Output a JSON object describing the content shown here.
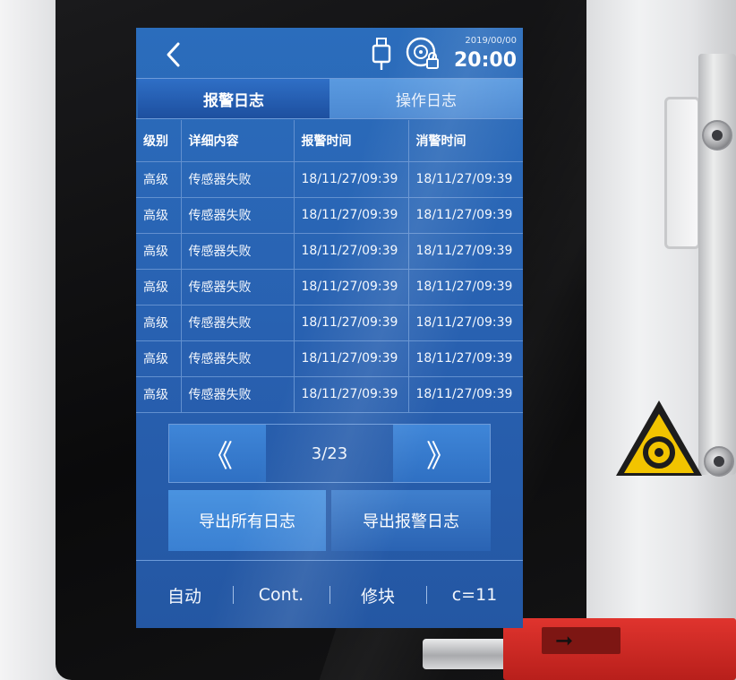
{
  "header": {
    "date": "2019/00/00",
    "time": "20:00",
    "icons": [
      "back-chevron-icon",
      "usb-icon",
      "lock-disc-icon"
    ]
  },
  "tabs": [
    {
      "label": "报警日志",
      "active": true
    },
    {
      "label": "操作日志",
      "active": false
    }
  ],
  "table": {
    "columns": [
      "级别",
      "详细内容",
      "报警时间",
      "消警时间"
    ],
    "rows": [
      [
        "高级",
        "传感器失败",
        "18/11/27/09:39",
        "18/11/27/09:39"
      ],
      [
        "高级",
        "传感器失败",
        "18/11/27/09:39",
        "18/11/27/09:39"
      ],
      [
        "高级",
        "传感器失败",
        "18/11/27/09:39",
        "18/11/27/09:39"
      ],
      [
        "高级",
        "传感器失败",
        "18/11/27/09:39",
        "18/11/27/09:39"
      ],
      [
        "高级",
        "传感器失败",
        "18/11/27/09:39",
        "18/11/27/09:39"
      ],
      [
        "高级",
        "传感器失败",
        "18/11/27/09:39",
        "18/11/27/09:39"
      ],
      [
        "高级",
        "传感器失败",
        "18/11/27/09:39",
        "18/11/27/09:39"
      ]
    ]
  },
  "pager": {
    "prev_symbol": "《",
    "next_symbol": "》",
    "page_label": "3/23"
  },
  "actions": {
    "export_all": "导出所有日志",
    "export_alarm": "导出报警日志"
  },
  "status": {
    "items": [
      "自动",
      "Cont.",
      "修块",
      "c=11"
    ]
  },
  "colors": {
    "screen_blue": "#2b6dbc",
    "tab_active": "#1d4f9f",
    "hazard_yellow": "#f2c400",
    "red_part": "#d22c27"
  }
}
